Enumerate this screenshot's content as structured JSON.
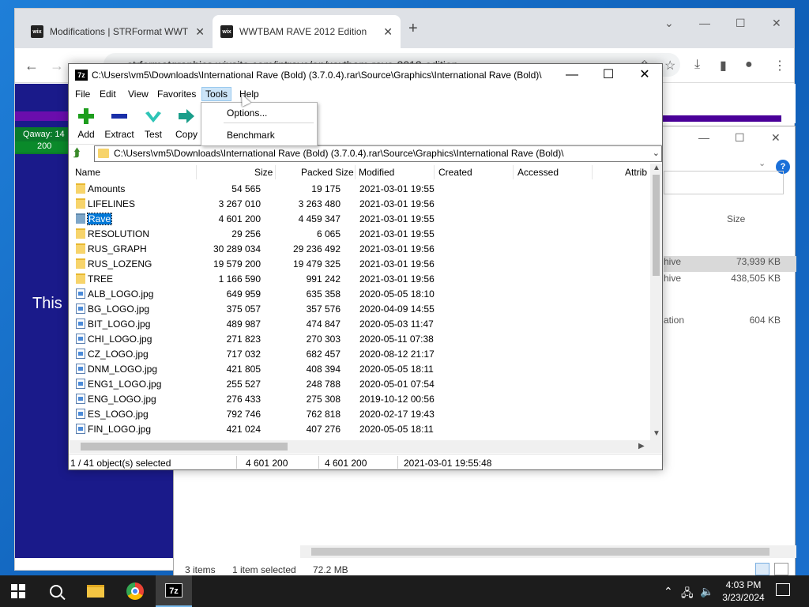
{
  "chrome": {
    "tab1_title": "Modifications | STRFormat WWT",
    "tab2_title": "WWTBAM RAVE 2012 Edition",
    "favicon_text": "wix",
    "new_tab": "+",
    "url": "strformatgraphics.wixsite.com/intrave/en/wwtbam-rave-2012-edition",
    "page": {
      "qaway_label": "Qaway: 14",
      "qaway_value": "200",
      "partial_text": "This"
    }
  },
  "explorer": {
    "size_header": "Size",
    "rows": [
      {
        "type": "hive",
        "size": "73,939 KB"
      },
      {
        "type": "hive",
        "size": "438,505 KB"
      },
      {
        "type": "ation",
        "size": "604 KB"
      }
    ],
    "status": {
      "items": "3 items",
      "selected": "1 item selected",
      "size": "72.2 MB"
    }
  },
  "sevenzip": {
    "title": "C:\\Users\\vm5\\Downloads\\International Rave (Bold) (3.7.0.4).rar\\Source\\Graphics\\International Rave (Bold)\\",
    "icon_text": "7z",
    "menus": [
      "File",
      "Edit",
      "View",
      "Favorites",
      "Tools",
      "Help"
    ],
    "toolbar": [
      {
        "label": "Add",
        "icon": "plus-icon"
      },
      {
        "label": "Extract",
        "icon": "minus-icon"
      },
      {
        "label": "Test",
        "icon": "check-icon"
      },
      {
        "label": "Copy",
        "icon": "arrow-right-icon"
      }
    ],
    "address": "C:\\Users\\vm5\\Downloads\\International Rave (Bold) (3.7.0.4).rar\\Source\\Graphics\\International Rave (Bold)\\",
    "columns": [
      "Name",
      "Size",
      "Packed Size",
      "Modified",
      "Created",
      "Accessed",
      "Attrib"
    ],
    "files": [
      {
        "name": "Amounts",
        "type": "folder",
        "size": "54 565",
        "packed": "19 175",
        "modified": "2021-03-01 19:55"
      },
      {
        "name": "LIFELINES",
        "type": "folder",
        "size": "3 267 010",
        "packed": "3 263 480",
        "modified": "2021-03-01 19:56"
      },
      {
        "name": "Rave",
        "type": "folder",
        "size": "4 601 200",
        "packed": "4 459 347",
        "modified": "2021-03-01 19:55",
        "selected": true
      },
      {
        "name": "RESOLUTION",
        "type": "folder",
        "size": "29 256",
        "packed": "6 065",
        "modified": "2021-03-01 19:55"
      },
      {
        "name": "RUS_GRAPH",
        "type": "folder",
        "size": "30 289 034",
        "packed": "29 236 492",
        "modified": "2021-03-01 19:56"
      },
      {
        "name": "RUS_LOZENG",
        "type": "folder",
        "size": "19 579 200",
        "packed": "19 479 325",
        "modified": "2021-03-01 19:56"
      },
      {
        "name": "TREE",
        "type": "folder",
        "size": "1 166 590",
        "packed": "991 242",
        "modified": "2021-03-01 19:56"
      },
      {
        "name": "ALB_LOGO.jpg",
        "type": "file",
        "size": "649 959",
        "packed": "635 358",
        "modified": "2020-05-05 18:10"
      },
      {
        "name": "BG_LOGO.jpg",
        "type": "file",
        "size": "375 057",
        "packed": "357 576",
        "modified": "2020-04-09 14:55"
      },
      {
        "name": "BIT_LOGO.jpg",
        "type": "file",
        "size": "489 987",
        "packed": "474 847",
        "modified": "2020-05-03 11:47"
      },
      {
        "name": "CHI_LOGO.jpg",
        "type": "file",
        "size": "271 823",
        "packed": "270 303",
        "modified": "2020-05-11 07:38"
      },
      {
        "name": "CZ_LOGO.jpg",
        "type": "file",
        "size": "717 032",
        "packed": "682 457",
        "modified": "2020-08-12 21:17"
      },
      {
        "name": "DNM_LOGO.jpg",
        "type": "file",
        "size": "421 805",
        "packed": "408 394",
        "modified": "2020-05-05 18:11"
      },
      {
        "name": "ENG1_LOGO.jpg",
        "type": "file",
        "size": "255 527",
        "packed": "248 788",
        "modified": "2020-05-01 07:54"
      },
      {
        "name": "ENG_LOGO.jpg",
        "type": "file",
        "size": "276 433",
        "packed": "275 308",
        "modified": "2019-10-12 00:56"
      },
      {
        "name": "ES_LOGO.jpg",
        "type": "file",
        "size": "792 746",
        "packed": "762 818",
        "modified": "2020-02-17 19:43"
      },
      {
        "name": "FIN_LOGO.jpg",
        "type": "file",
        "size": "421 024",
        "packed": "407 276",
        "modified": "2020-05-05 18:11"
      }
    ],
    "status": {
      "selection": "1 / 41 object(s) selected",
      "size": "4 601 200",
      "packed": "4 601 200",
      "modified": "2021-03-01 19:55:48"
    },
    "tools_menu": [
      "Options...",
      "Benchmark"
    ]
  },
  "taskbar": {
    "time": "4:03 PM",
    "date": "3/23/2024",
    "app_7z": "7z"
  },
  "colors": {
    "selection": "#0078d7",
    "menu_highlight": "#cce4f7",
    "taskbar": "#1c1c1c"
  }
}
